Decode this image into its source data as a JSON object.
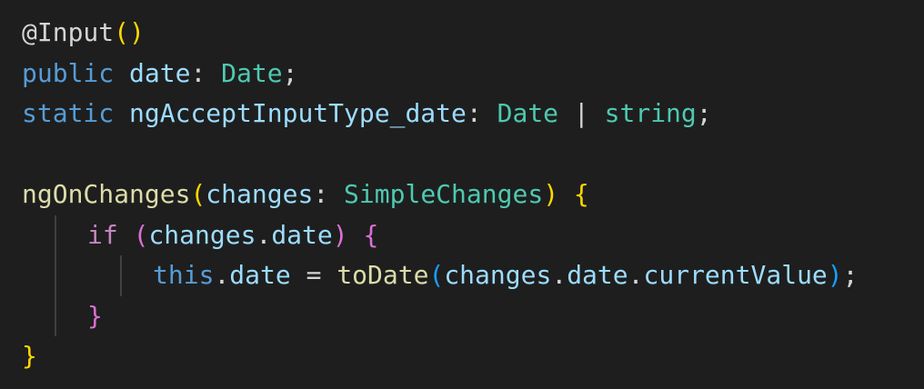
{
  "editor": {
    "lines": [
      {
        "tokens": [
          "@Input",
          "(",
          ")"
        ]
      },
      {
        "tokens": [
          "public",
          " ",
          "date",
          ": ",
          "Date",
          ";"
        ]
      },
      {
        "tokens": [
          "static",
          " ",
          "ngAcceptInputType_date",
          ": ",
          "Date",
          " | ",
          "string",
          ";"
        ]
      },
      {
        "tokens": []
      },
      {
        "tokens": [
          "ngOnChanges",
          "(",
          "changes",
          ": ",
          "SimpleChanges",
          ")",
          " ",
          "{"
        ]
      },
      {
        "tokens": [
          "if",
          " ",
          "(",
          "changes",
          ".",
          "date",
          ")",
          " ",
          "{"
        ]
      },
      {
        "tokens": [
          "this",
          ".",
          "date",
          " = ",
          "toDate",
          "(",
          "changes",
          ".",
          "date",
          ".",
          "currentValue",
          ")",
          ";"
        ]
      },
      {
        "tokens": [
          "}"
        ]
      },
      {
        "tokens": [
          "}"
        ]
      }
    ]
  },
  "colors": {
    "background": "#1e1e1e",
    "keyword": "#569cd6",
    "type": "#4ec9b0",
    "function": "#dcdcaa",
    "variable": "#9cdcfe",
    "control": "#c586c0",
    "bracket_level_1": "#ffd700",
    "bracket_level_2": "#da70d6",
    "bracket_level_3": "#179fff",
    "indent_guide": "#404040"
  }
}
